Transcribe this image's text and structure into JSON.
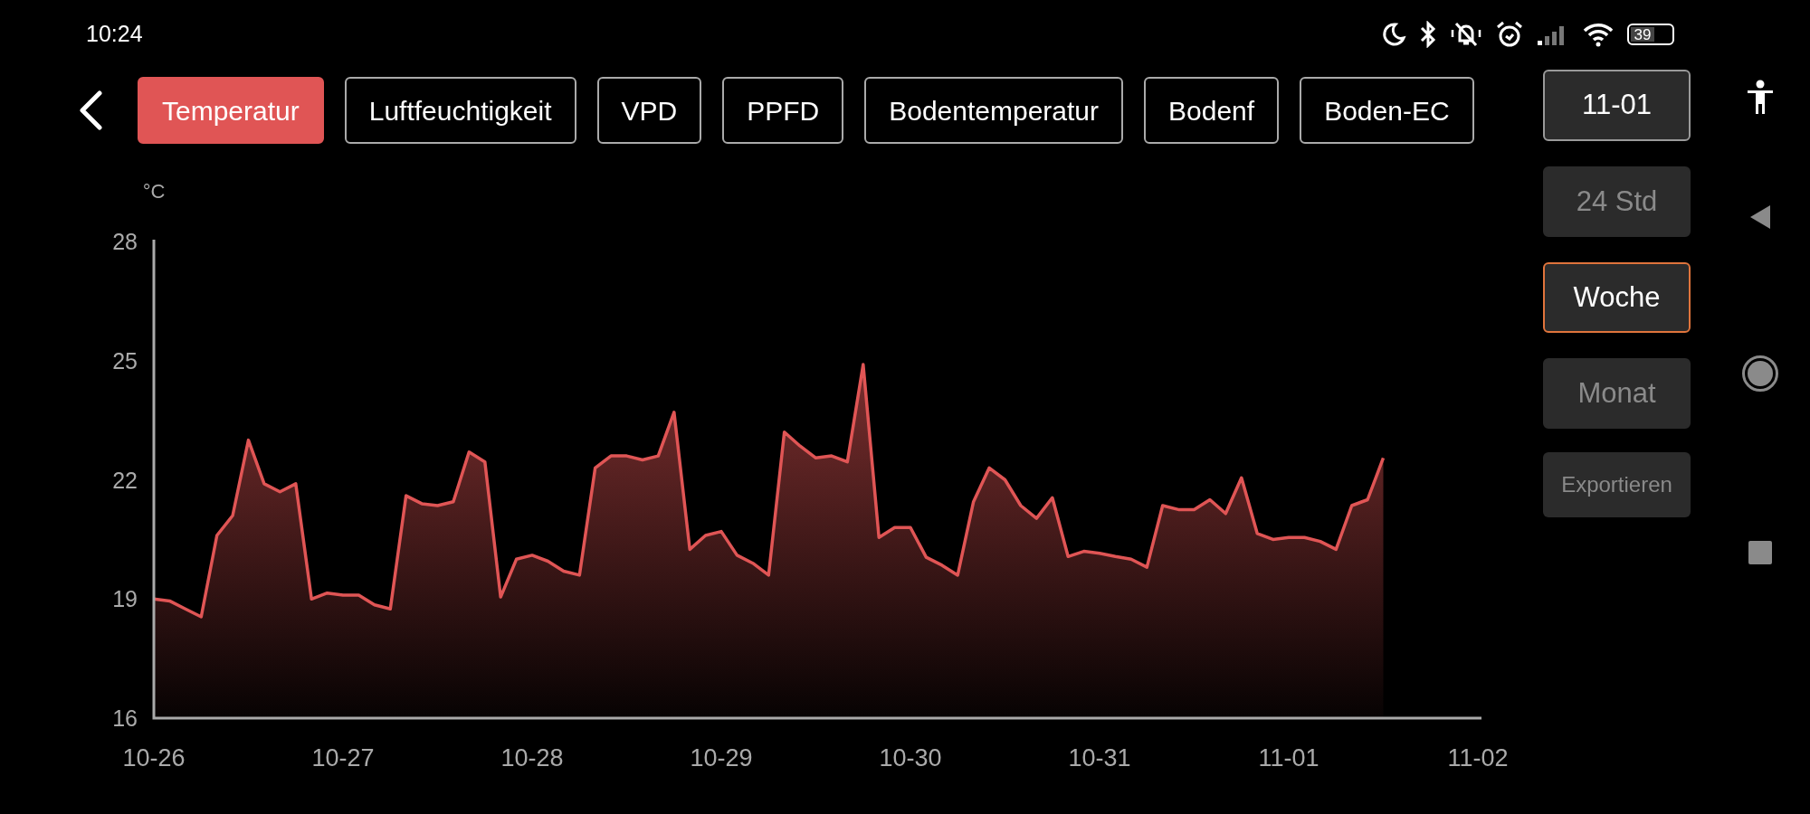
{
  "status_bar": {
    "time": "10:24",
    "battery": "39"
  },
  "tabs": [
    {
      "label": "Temperatur",
      "selected": true
    },
    {
      "label": "Luftfeuchtigkeit",
      "selected": false
    },
    {
      "label": "VPD",
      "selected": false
    },
    {
      "label": "PPFD",
      "selected": false
    },
    {
      "label": "Bodentemperatur",
      "selected": false
    },
    {
      "label": "Bodenf",
      "selected": false
    },
    {
      "label": "Boden-EC",
      "selected": false
    }
  ],
  "date_button": "11-01",
  "range_buttons": [
    {
      "label": "24 Std",
      "selected": false
    },
    {
      "label": "Woche",
      "selected": true
    },
    {
      "label": "Monat",
      "selected": false
    }
  ],
  "export_button": "Exportieren",
  "chart": {
    "chart_data": {
      "type": "area",
      "ylabel": "°C",
      "ylim": [
        16,
        28
      ],
      "yticks": [
        16,
        19,
        22,
        25,
        28
      ],
      "categories": [
        "10-26",
        null,
        null,
        null,
        null,
        null,
        null,
        null,
        null,
        null,
        null,
        null,
        "10-27",
        null,
        null,
        null,
        null,
        null,
        null,
        null,
        null,
        null,
        null,
        null,
        "10-28",
        null,
        null,
        null,
        null,
        null,
        null,
        null,
        null,
        null,
        null,
        null,
        "10-29",
        null,
        null,
        null,
        null,
        null,
        null,
        null,
        null,
        null,
        null,
        null,
        "10-30",
        null,
        null,
        null,
        null,
        null,
        null,
        null,
        null,
        null,
        null,
        null,
        "10-31",
        null,
        null,
        null,
        null,
        null,
        null,
        null,
        null,
        null,
        null,
        null,
        "11-01",
        null,
        null,
        null,
        null,
        null,
        null,
        null,
        null,
        null,
        null,
        null,
        "11-02"
      ],
      "series": [
        {
          "color": "#e05555",
          "values": [
            19.0,
            18.95,
            18.75,
            18.55,
            20.6,
            21.1,
            23.0,
            21.9,
            21.7,
            21.9,
            19.0,
            19.15,
            19.1,
            19.1,
            18.85,
            18.75,
            21.6,
            21.4,
            21.35,
            21.45,
            22.7,
            22.45,
            19.05,
            20.0,
            20.1,
            19.95,
            19.7,
            19.6,
            22.3,
            22.6,
            22.6,
            22.5,
            22.6,
            23.7,
            20.25,
            20.6,
            20.7,
            20.1,
            19.9,
            19.6,
            23.2,
            22.85,
            22.55,
            22.6,
            22.45,
            24.9,
            20.55,
            20.8,
            20.8,
            20.05,
            19.85,
            19.6,
            21.45,
            22.3,
            22.0,
            21.35,
            21.03,
            21.55,
            20.07,
            20.2,
            20.15,
            20.07,
            20.0,
            19.8,
            21.35,
            21.25,
            21.25,
            21.5,
            21.15,
            22.05,
            20.65,
            20.5,
            20.55,
            20.55,
            20.45,
            20.25,
            21.35,
            21.5,
            22.55,
            null,
            null,
            null,
            null,
            null,
            null
          ]
        }
      ]
    }
  }
}
